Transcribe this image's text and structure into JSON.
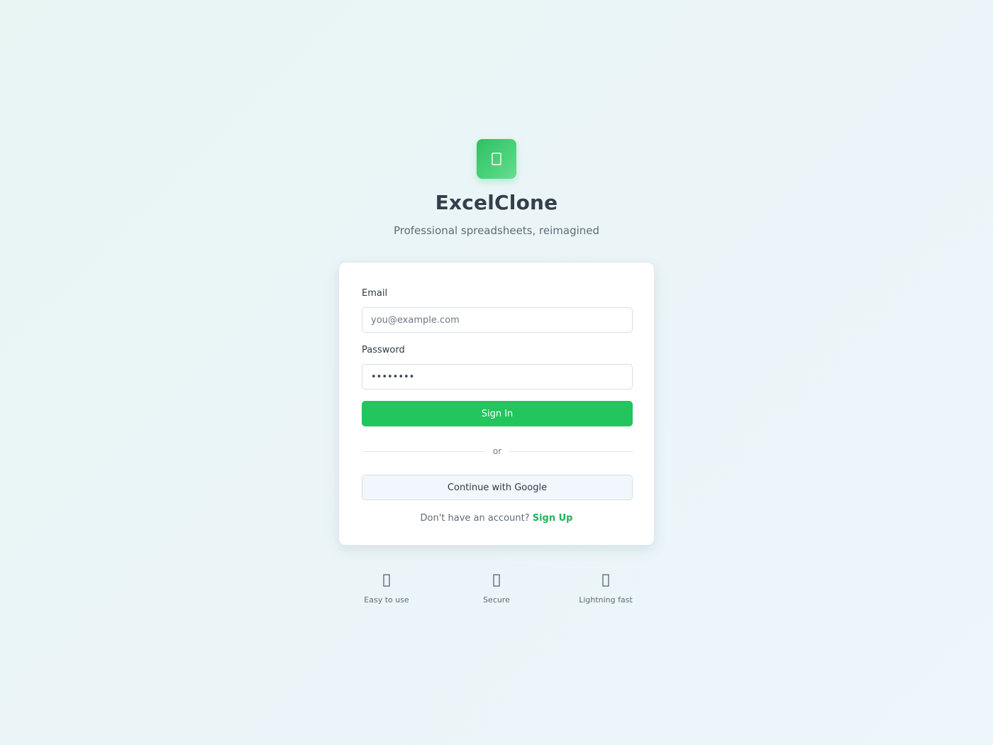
{
  "brand": {
    "title": "ExcelClone",
    "subtitle": "Professional spreadsheets, reimagined",
    "logo_icon": "spreadsheet-icon",
    "accent_color": "#22c55e"
  },
  "login_form": {
    "email_label": "Email",
    "email_placeholder": "you@example.com",
    "email_value": "",
    "password_label": "Password",
    "password_value": "••••••••",
    "sign_in_label": "Sign In",
    "divider_text": "or",
    "google_label": "Continue with Google",
    "signup_prompt": "Don't have an account?",
    "signup_link": "Sign Up"
  },
  "features": [
    {
      "label": "Easy to use",
      "icon": "check-icon"
    },
    {
      "label": "Secure",
      "icon": "lock-icon"
    },
    {
      "label": "Lightning fast",
      "icon": "bolt-icon"
    }
  ]
}
